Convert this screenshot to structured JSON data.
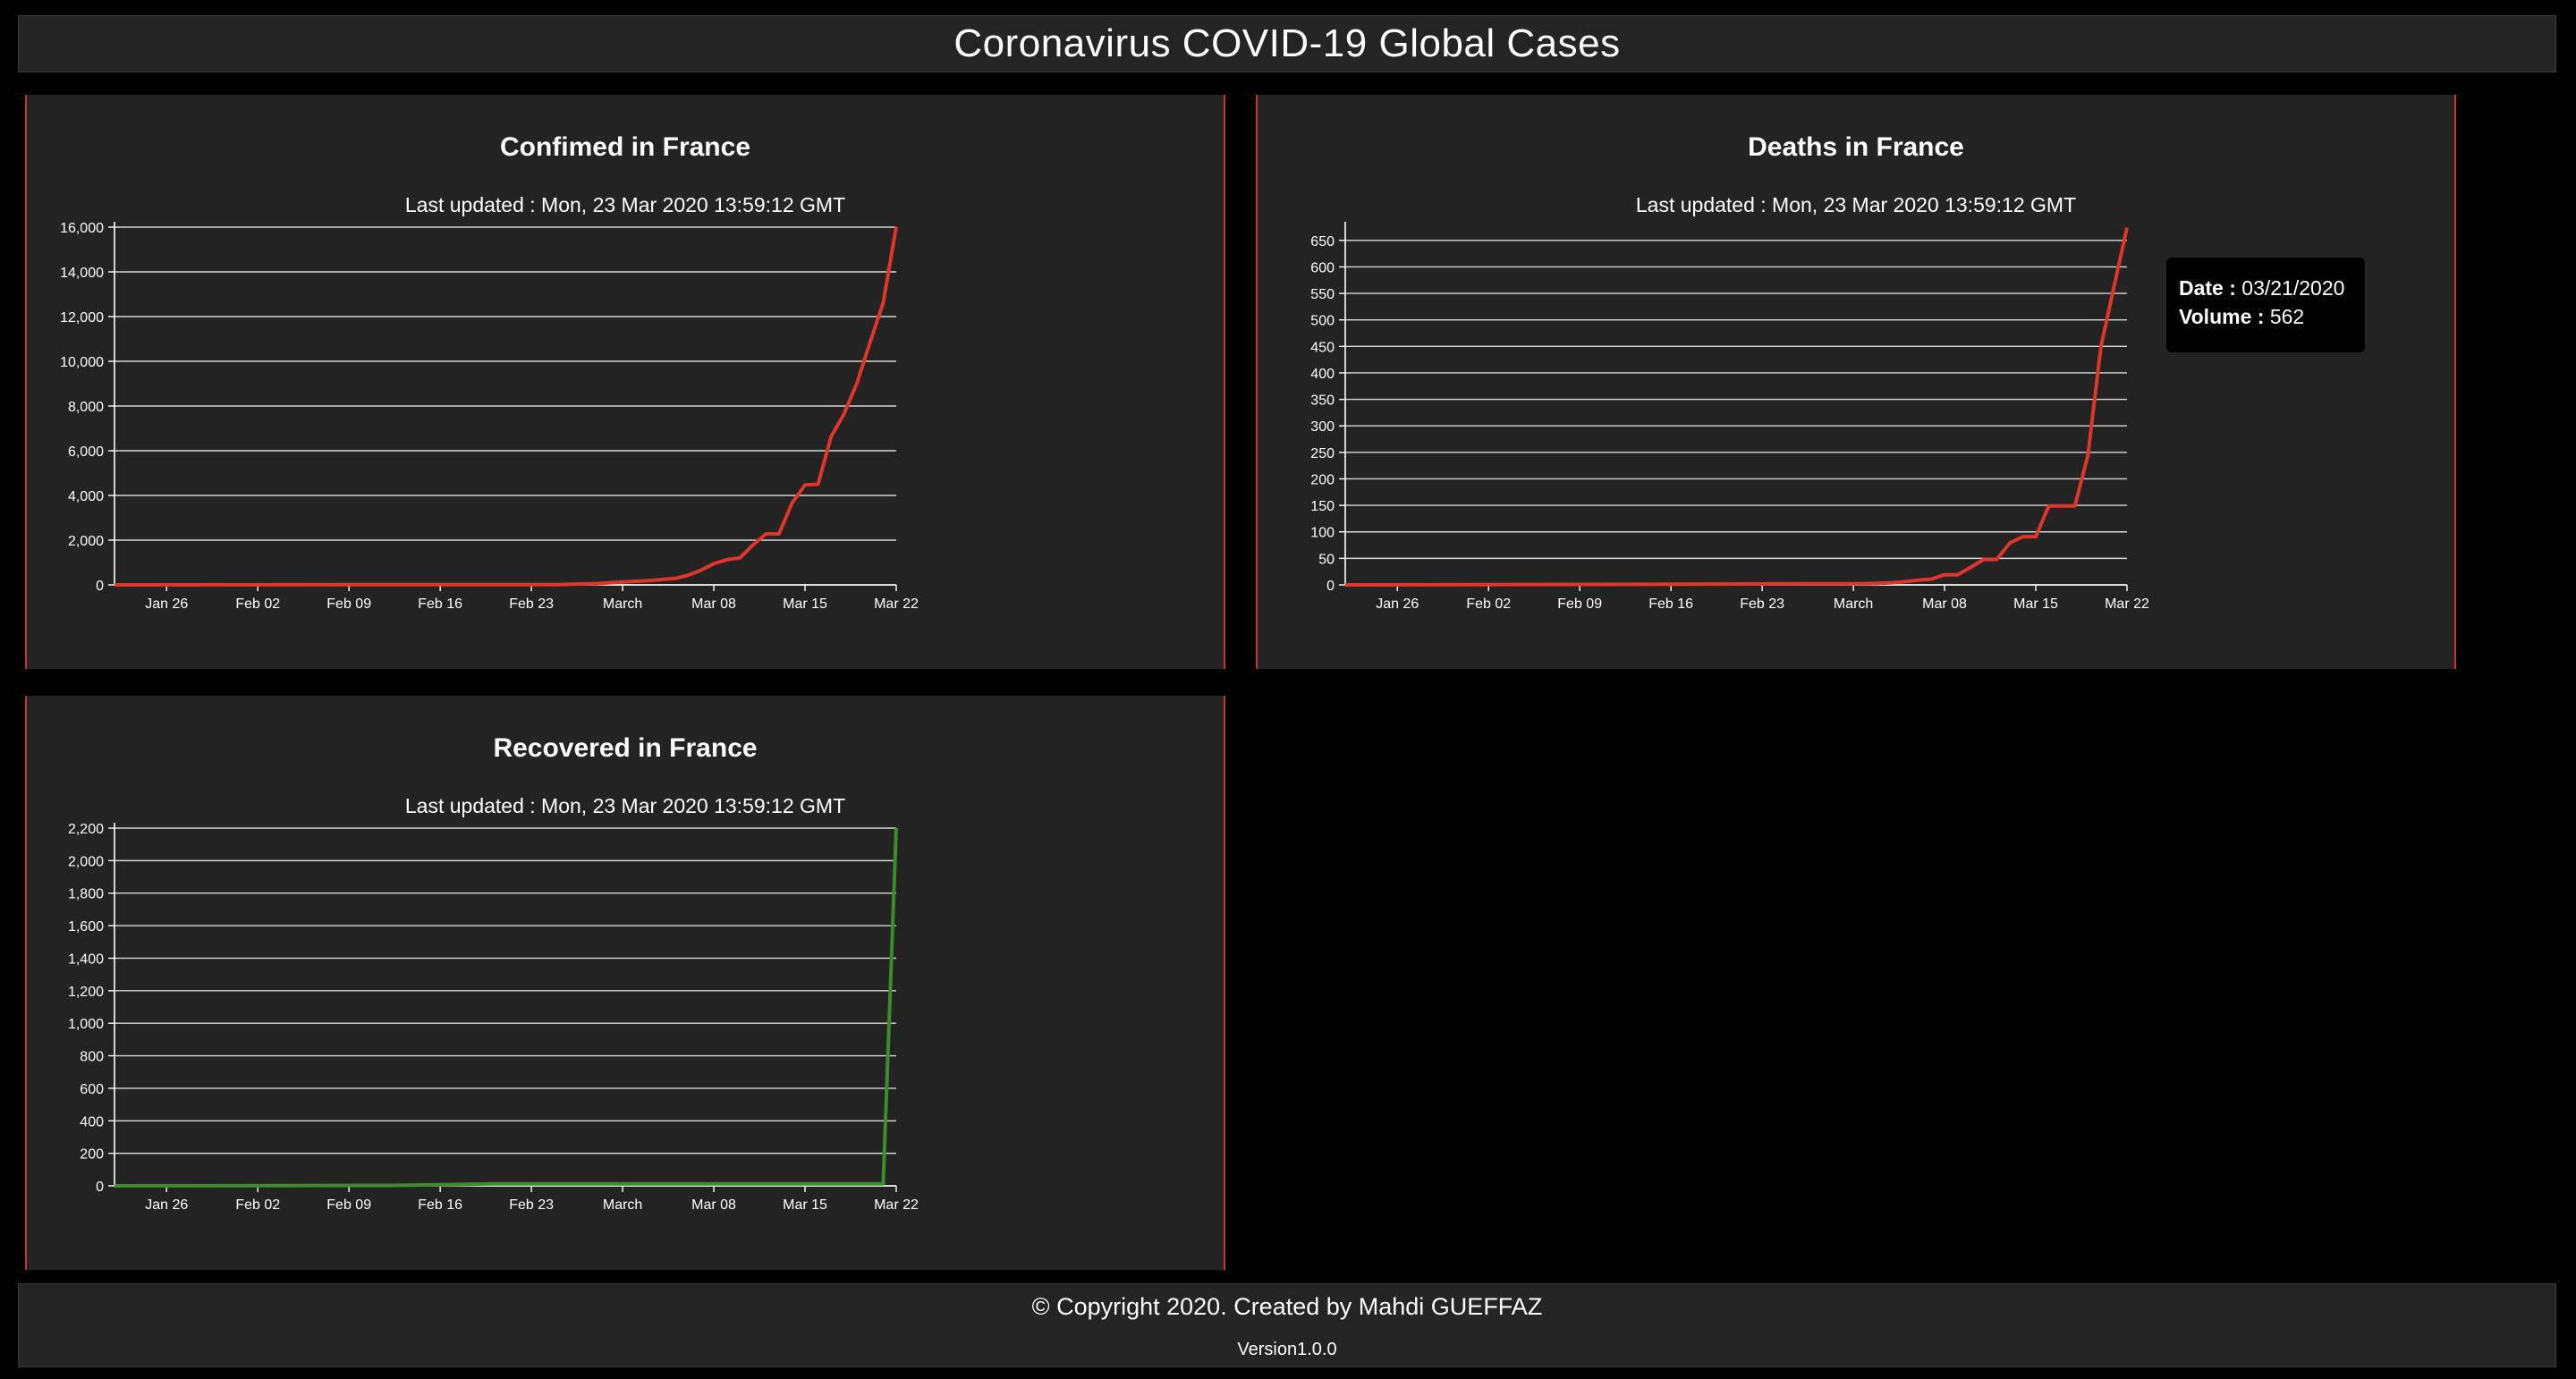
{
  "header": {
    "title": "Coronavirus COVID-19 Global Cases"
  },
  "footer": {
    "copyright": "© Copyright 2020. Created by Mahdi GUEFFAZ",
    "version": "Version1.0.0"
  },
  "tooltip": {
    "date_label": "Date :",
    "date_value": "03/21/2020",
    "volume_label": "Volume :",
    "volume_value": "562"
  },
  "chart_data": [
    {
      "id": "confirmed",
      "type": "line",
      "title": "Confimed in France",
      "subtitle": "Last updated : Mon, 23 Mar 2020 13:59:12 GMT",
      "color": "#e0352b",
      "xlim": [
        "2020-01-22",
        "2020-03-22"
      ],
      "xticks": [
        "Jan 26",
        "Feb 02",
        "Feb 09",
        "Feb 16",
        "Feb 23",
        "March",
        "Mar 08",
        "Mar 15",
        "Mar 22"
      ],
      "ylim": [
        0,
        16000
      ],
      "yticks": [
        "0",
        "2,000",
        "4,000",
        "6,000",
        "8,000",
        "10,000",
        "12,000",
        "14,000",
        "16,000"
      ],
      "grid": true,
      "x": [
        "2020-01-22",
        "2020-01-24",
        "2020-02-01",
        "2020-02-15",
        "2020-02-25",
        "2020-02-28",
        "2020-03-01",
        "2020-03-03",
        "2020-03-05",
        "2020-03-06",
        "2020-03-07",
        "2020-03-08",
        "2020-03-09",
        "2020-03-10",
        "2020-03-11",
        "2020-03-12",
        "2020-03-13",
        "2020-03-14",
        "2020-03-15",
        "2020-03-16",
        "2020-03-17",
        "2020-03-18",
        "2020-03-19",
        "2020-03-20",
        "2020-03-21",
        "2020-03-22"
      ],
      "values": [
        0,
        2,
        6,
        12,
        12,
        57,
        130,
        191,
        285,
        423,
        653,
        949,
        1126,
        1209,
        1784,
        2281,
        2281,
        3661,
        4469,
        4499,
        6633,
        7652,
        9043,
        10871,
        12612,
        16018
      ]
    },
    {
      "id": "deaths",
      "type": "line",
      "title": "Deaths in France",
      "subtitle": "Last updated : Mon, 23 Mar 2020 13:59:12 GMT",
      "color": "#e0352b",
      "xlim": [
        "2020-01-22",
        "2020-03-22"
      ],
      "xticks": [
        "Jan 26",
        "Feb 02",
        "Feb 09",
        "Feb 16",
        "Feb 23",
        "March",
        "Mar 08",
        "Mar 15",
        "Mar 22"
      ],
      "ylim": [
        0,
        675
      ],
      "yticks": [
        "0",
        "50",
        "100",
        "150",
        "200",
        "250",
        "300",
        "350",
        "400",
        "450",
        "500",
        "550",
        "600",
        "650"
      ],
      "grid": true,
      "x": [
        "2020-01-22",
        "2020-02-14",
        "2020-02-26",
        "2020-03-01",
        "2020-03-03",
        "2020-03-04",
        "2020-03-05",
        "2020-03-06",
        "2020-03-07",
        "2020-03-08",
        "2020-03-09",
        "2020-03-10",
        "2020-03-11",
        "2020-03-12",
        "2020-03-13",
        "2020-03-14",
        "2020-03-15",
        "2020-03-16",
        "2020-03-17",
        "2020-03-18",
        "2020-03-19",
        "2020-03-20",
        "2020-03-21",
        "2020-03-22"
      ],
      "values": [
        0,
        1,
        2,
        2,
        3,
        4,
        6,
        9,
        11,
        19,
        19,
        33,
        48,
        48,
        79,
        91,
        91,
        149,
        149,
        149,
        244,
        450,
        562,
        674
      ]
    },
    {
      "id": "recovered",
      "type": "line",
      "title": "Recovered in France",
      "subtitle": "Last updated : Mon, 23 Mar 2020 13:59:12 GMT",
      "color": "#3c8c2e",
      "xlim": [
        "2020-01-22",
        "2020-03-22"
      ],
      "xticks": [
        "Jan 26",
        "Feb 02",
        "Feb 09",
        "Feb 16",
        "Feb 23",
        "March",
        "Mar 08",
        "Mar 15",
        "Mar 22"
      ],
      "ylim": [
        0,
        2200
      ],
      "yticks": [
        "0",
        "200",
        "400",
        "600",
        "800",
        "1,000",
        "1,200",
        "1,400",
        "1,600",
        "1,800",
        "2,000",
        "2,200"
      ],
      "grid": true,
      "x": [
        "2020-01-22",
        "2020-02-12",
        "2020-02-20",
        "2020-03-21",
        "2020-03-22"
      ],
      "values": [
        0,
        2,
        12,
        12,
        2200
      ]
    }
  ]
}
